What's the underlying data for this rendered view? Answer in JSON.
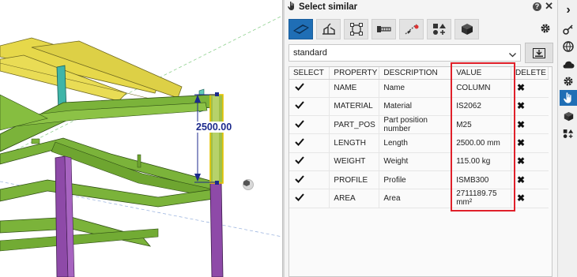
{
  "viewport": {
    "dimension_label": "2500.00"
  },
  "panel": {
    "title": "Select similar",
    "help_icon": "?",
    "close_icon": "✕",
    "toolbar": [
      "profile-object-icon",
      "weld-icon",
      "component-icon",
      "bolt-icon",
      "rebar-icon",
      "add-shapes-icon",
      "cube-icon"
    ],
    "property_set": "standard",
    "table": {
      "headers": [
        "SELECT",
        "PROPERTY",
        "DESCRIPTION",
        "VALUE",
        "DELETE"
      ],
      "rows": [
        {
          "property": "NAME",
          "description": "Name",
          "value": "COLUMN"
        },
        {
          "property": "MATERIAL",
          "description": "Material",
          "value": "IS2062"
        },
        {
          "property": "PART_POS",
          "description": "Part position number",
          "value": "M25"
        },
        {
          "property": "LENGTH",
          "description": "Length",
          "value": "2500.00 mm"
        },
        {
          "property": "WEIGHT",
          "description": "Weight",
          "value": "115.00 kg"
        },
        {
          "property": "PROFILE",
          "description": "Profile",
          "value": "ISMB300"
        },
        {
          "property": "AREA",
          "description": "Area",
          "value": "2711189.75 mm²"
        }
      ]
    }
  },
  "side_strip": {
    "expand_icon": "›",
    "items": [
      "key-icon",
      "globe-icon",
      "cloud-icon",
      "gear-icon",
      "select-hand-icon",
      "cube-icon",
      "shapes-icon"
    ],
    "active": "select-hand-icon"
  },
  "colors": {
    "accent": "#1f6eb5",
    "highlight": "#e0202a",
    "beam_green": "#7bb33a",
    "beam_yellow": "#e6d84a",
    "column_purple": "#8e4aa8",
    "column_teal": "#3fb5a8"
  }
}
